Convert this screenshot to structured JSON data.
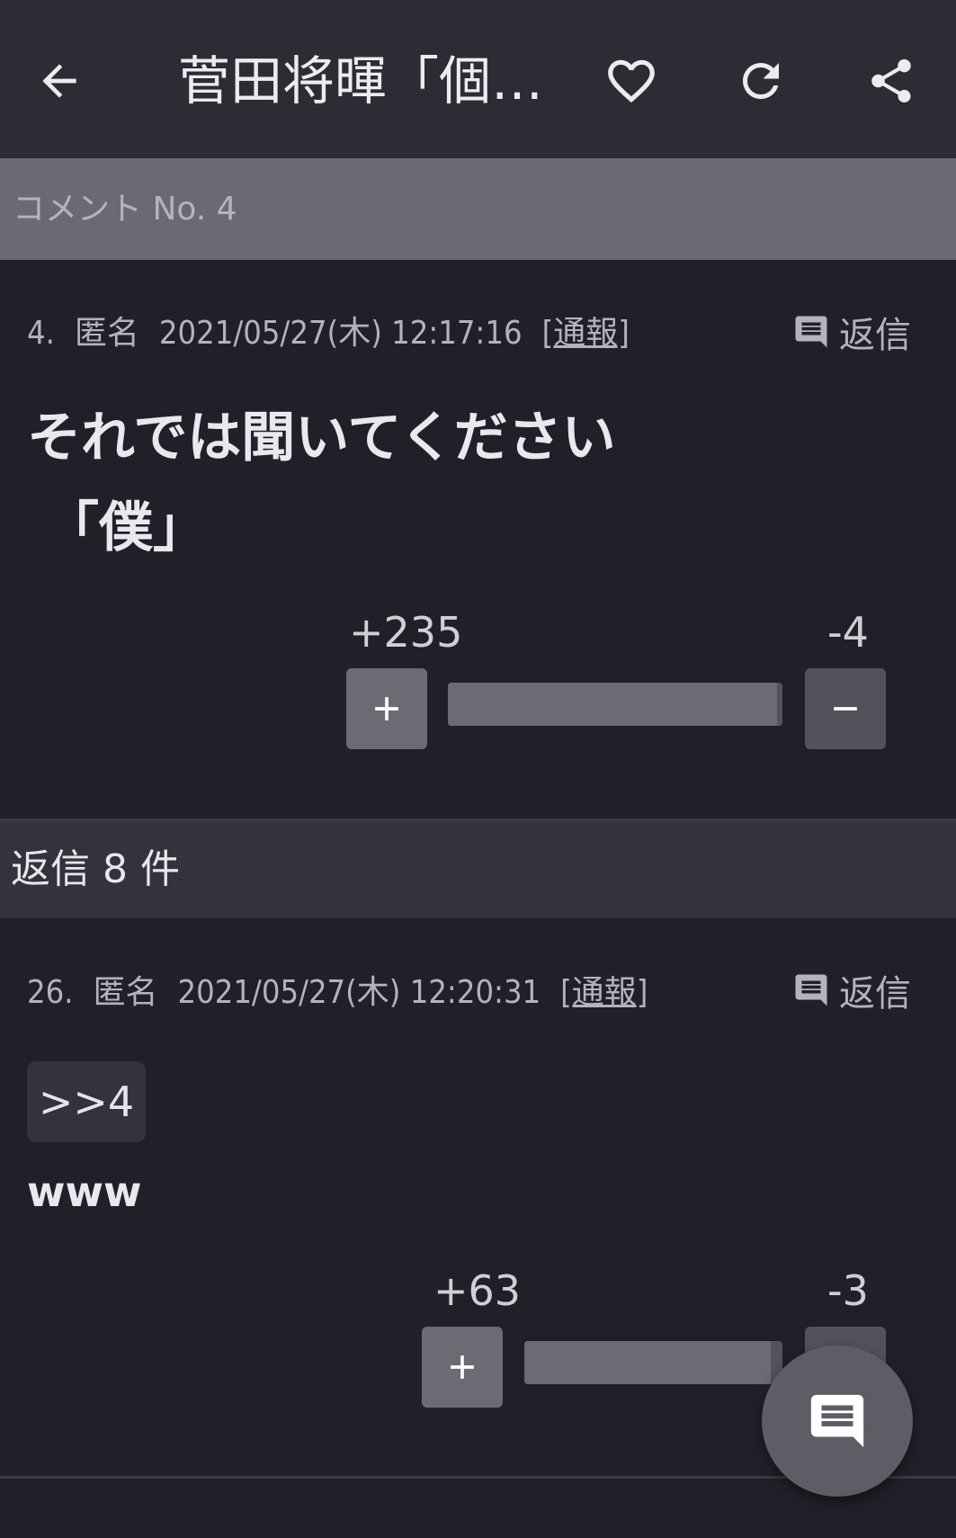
{
  "header": {
    "title": "菅田将暉「個…",
    "back_icon": "back-arrow-icon",
    "favorite_icon": "heart-outline-icon",
    "refresh_icon": "refresh-icon",
    "share_icon": "share-icon"
  },
  "section": {
    "label": "コメント No. 4"
  },
  "main_comment": {
    "number": "4.",
    "author": "匿名",
    "datetime": "2021/05/27(木) 12:17:16",
    "report": "[通報]",
    "reply_label": "返信",
    "body_line1": "それでは聞いてください",
    "body_line2": "「僕」",
    "plus_votes": "+235",
    "minus_votes": "-4",
    "plus_share": 0.983
  },
  "replies": {
    "label": "返信 8 件"
  },
  "reply_comment": {
    "number": "26.",
    "author": "匿名",
    "datetime": "2021/05/27(木) 12:20:31",
    "report": "[通報]",
    "reply_label": "返信",
    "anchor": ">>4",
    "body": "www",
    "plus_votes": "+63",
    "minus_votes": "-3",
    "plus_share": 0.955
  },
  "fab": {
    "icon": "comment-icon"
  },
  "colors": {
    "background": "#212029",
    "header": "#2d2c35",
    "section": "#6b6a73",
    "accent": "#6c6b74"
  }
}
